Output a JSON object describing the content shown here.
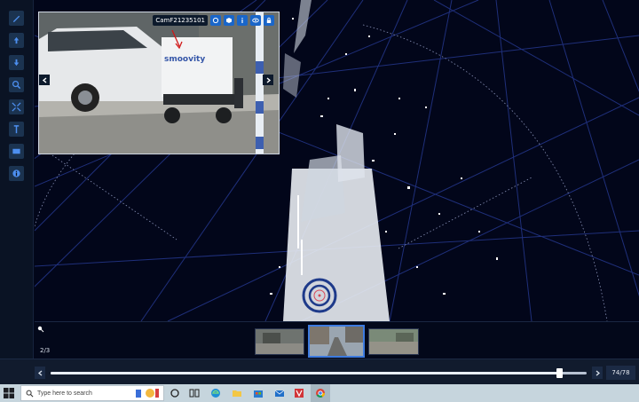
{
  "camera": {
    "name": "CamF21235101",
    "photo_sign_text": "smoovity"
  },
  "toolbar": {
    "tools": [
      {
        "icon": "pen-icon"
      },
      {
        "icon": "arrow-up-icon"
      },
      {
        "icon": "arrow-down-icon"
      },
      {
        "icon": "zoom-icon"
      },
      {
        "icon": "expand-icon"
      },
      {
        "icon": "height-icon"
      },
      {
        "icon": "box-icon"
      },
      {
        "icon": "info-icon"
      }
    ]
  },
  "thumbnails": {
    "counter": "2/3",
    "active_index": 1
  },
  "timeline": {
    "frame_label": "74/78",
    "current_frame": 74,
    "total_frames": 78
  },
  "taskbar": {
    "search_placeholder": "Type here to search"
  },
  "colors": {
    "accent": "#1a66c9",
    "grid": "#20307a",
    "background": "#02061a"
  }
}
